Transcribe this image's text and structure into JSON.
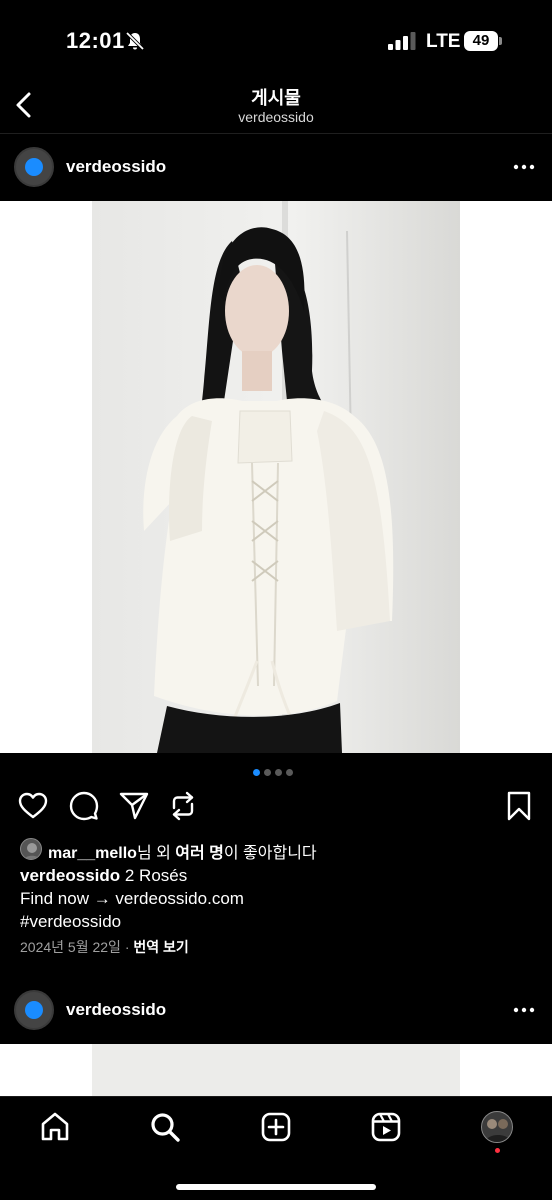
{
  "status_bar": {
    "time": "12:01",
    "network": "LTE",
    "battery": "49"
  },
  "header": {
    "title": "게시물",
    "subtitle": "verdeossido"
  },
  "post": {
    "username": "verdeossido",
    "carousel": {
      "total": 4,
      "active": 1
    },
    "likes": {
      "user": "mar__mello",
      "suffix_1": "님 외 ",
      "bold_part": "여러 명",
      "suffix_2": "이 좋아합니다"
    },
    "caption": {
      "username": "verdeossido",
      "text": " 2 Rosés",
      "line2": "Find now → verdeossido.com",
      "line3": "#verdeossido"
    },
    "date": "2024년 5월 22일",
    "separator": " · ",
    "translate": "번역 보기"
  },
  "next_post": {
    "username": "verdeossido"
  },
  "colors": {
    "accent": "#1a8cff",
    "background": "#000000",
    "notification": "#ff3040"
  },
  "icons": {
    "actions": [
      "heart-icon",
      "comment-icon",
      "share-icon",
      "repost-icon",
      "bookmark-icon"
    ],
    "tabs": [
      "home-icon",
      "search-icon",
      "create-icon",
      "reels-icon",
      "profile-avatar"
    ]
  }
}
